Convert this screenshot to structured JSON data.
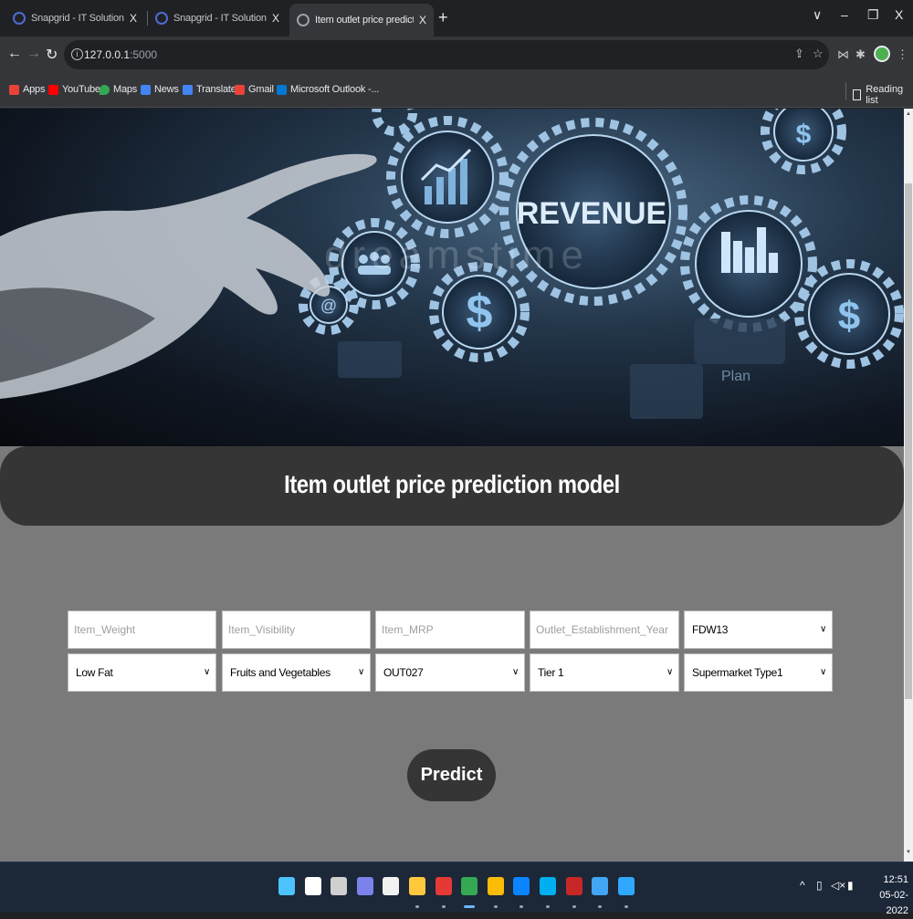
{
  "browser": {
    "tabs": [
      {
        "title": "Snapgrid - IT Solutions and Techno",
        "close": "X"
      },
      {
        "title": "Snapgrid - IT Solutions and Techno",
        "close": "X"
      },
      {
        "title": "Item outlet price prediction model",
        "close": "X"
      }
    ],
    "new_tab": "+",
    "window_controls": {
      "dropdown": "∨",
      "minimize": "–",
      "restore": "❐",
      "close": "X"
    },
    "url_host": "127.0.0.1",
    "url_port": ":5000",
    "bookmarks": [
      {
        "label": "Apps",
        "icon": "apps-grid-icon",
        "color": "#ea4335"
      },
      {
        "label": "YouTube",
        "icon": "youtube-icon",
        "color": "#ff0000"
      },
      {
        "label": "Maps",
        "icon": "maps-pin-icon",
        "color": "#34a853"
      },
      {
        "label": "News",
        "icon": "news-icon",
        "color": "#4285f4"
      },
      {
        "label": "Translate",
        "icon": "translate-icon",
        "color": "#4285f4"
      },
      {
        "label": "Gmail",
        "icon": "gmail-icon",
        "color": "#ea4335"
      },
      {
        "label": "Microsoft Outlook -...",
        "icon": "outlook-icon",
        "color": "#0078d4"
      }
    ],
    "reading_list": "Reading list"
  },
  "hero": {
    "gear_label": "REVENUE",
    "watermark": "dreamstime",
    "plan_text": "Plan"
  },
  "page": {
    "title": "Item outlet price prediction model",
    "inputs": [
      {
        "placeholder": "Item_Weight"
      },
      {
        "placeholder": "Item_Visibility"
      },
      {
        "placeholder": "Item_MRP"
      },
      {
        "placeholder": "Outlet_Establishment_Year"
      }
    ],
    "selects": [
      {
        "value": "FDW13"
      },
      {
        "value": "Low Fat"
      },
      {
        "value": "Fruits and Vegetables"
      },
      {
        "value": "OUT027"
      },
      {
        "value": "Tier 1"
      },
      {
        "value": "Supermarket Type1"
      }
    ],
    "predict_label": "Predict"
  },
  "taskbar": {
    "time": "12:51",
    "date": "05-02-2022",
    "apps": [
      {
        "icon": "windows-start-icon",
        "color": "#4cc2ff"
      },
      {
        "icon": "search-icon",
        "color": "#ffffff"
      },
      {
        "icon": "task-view-icon",
        "color": "#d0d0d0"
      },
      {
        "icon": "teams-chat-icon",
        "color": "#7b83eb"
      },
      {
        "icon": "store-icon",
        "color": "#f2f2f2"
      },
      {
        "icon": "file-explorer-icon",
        "color": "#ffc83d"
      },
      {
        "icon": "wps-office-icon",
        "color": "#e53935"
      },
      {
        "icon": "chrome-icon",
        "color": "#34a853"
      },
      {
        "icon": "chrome-alt-icon",
        "color": "#fbbc05"
      },
      {
        "icon": "vscode-icon",
        "color": "#0a84ff"
      },
      {
        "icon": "skype-icon",
        "color": "#00aff0"
      },
      {
        "icon": "kcs-app-icon",
        "color": "#c62828"
      },
      {
        "icon": "globe-app-icon",
        "color": "#42a5f5"
      },
      {
        "icon": "photoshop-icon",
        "color": "#31a8ff"
      }
    ]
  }
}
